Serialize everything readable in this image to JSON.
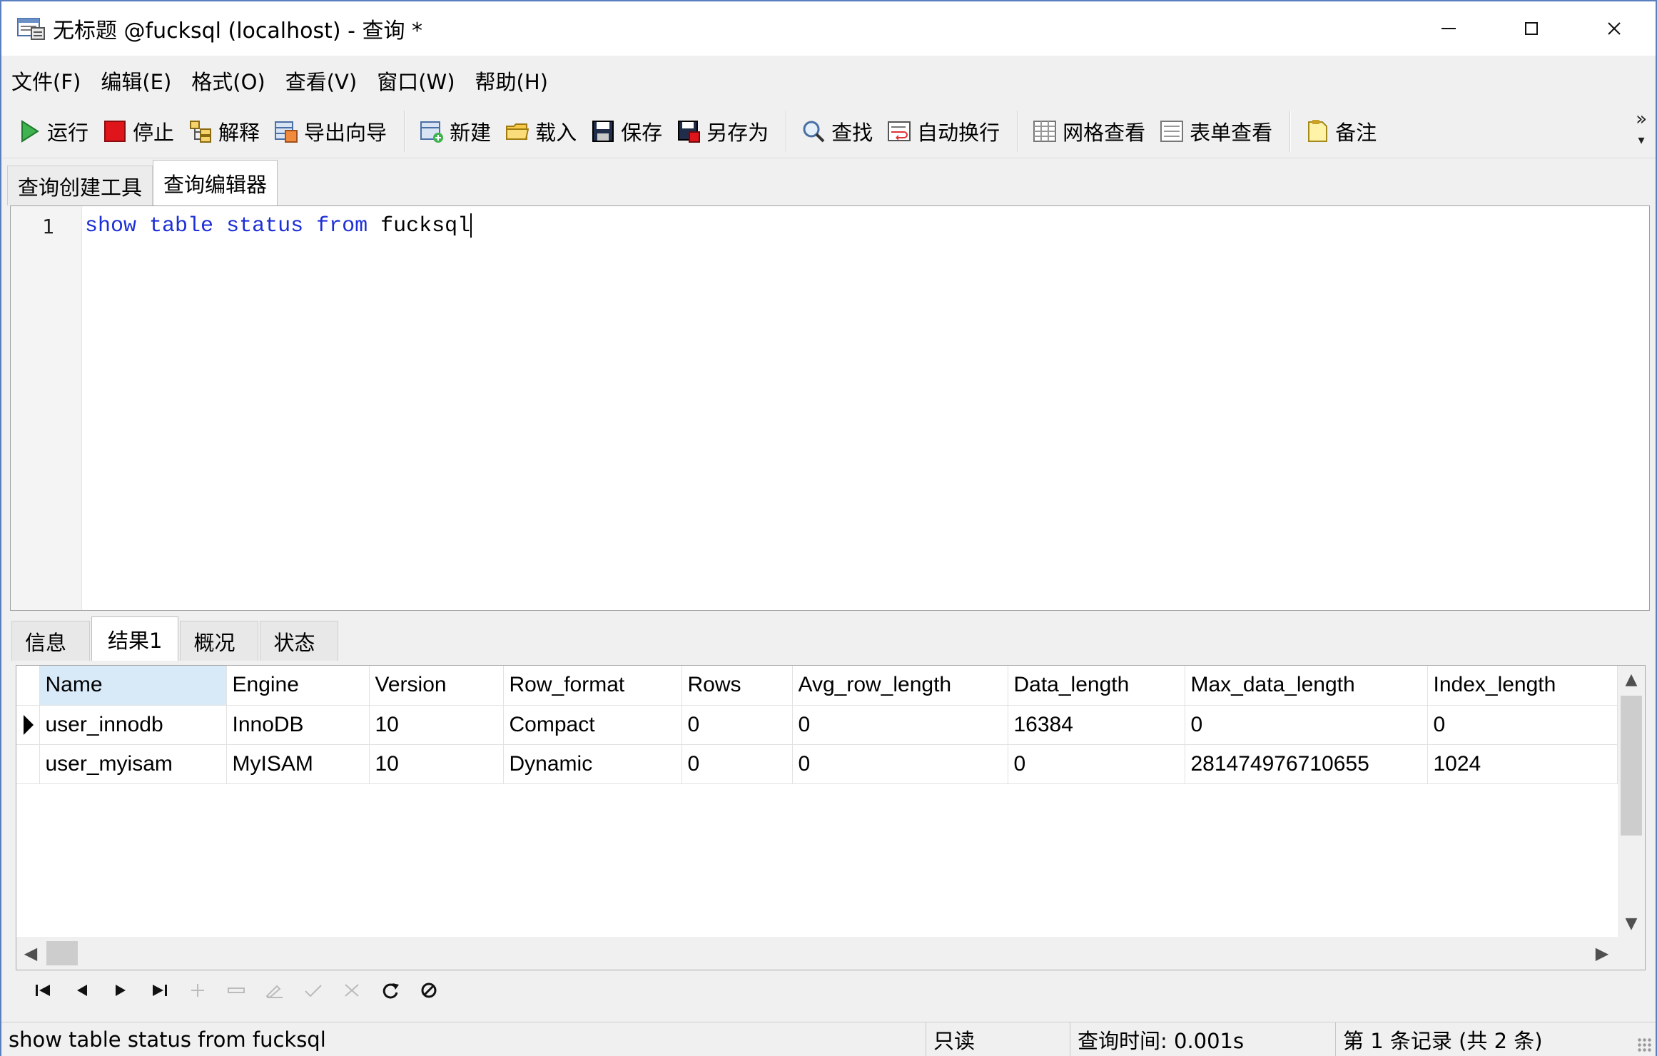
{
  "window": {
    "title": "无标题 @fucksql (localhost) - 查询 *",
    "minimize": "—",
    "maximize": "☐",
    "close": "✕"
  },
  "menu": [
    "文件(F)",
    "编辑(E)",
    "格式(O)",
    "查看(V)",
    "窗口(W)",
    "帮助(H)"
  ],
  "toolbar": {
    "run": "运行",
    "stop": "停止",
    "explain": "解释",
    "export": "导出向导",
    "new": "新建",
    "load": "载入",
    "save": "保存",
    "save_as": "另存为",
    "find": "查找",
    "word_wrap": "自动换行",
    "grid_view": "网格查看",
    "form_view": "表单查看",
    "note": "备注",
    "more": "»"
  },
  "query_tabs": {
    "builder": "查询创建工具",
    "editor": "查询编辑器"
  },
  "editor": {
    "line_number": "1",
    "code": {
      "kw1": "show",
      "kw2": "table",
      "kw3": "status",
      "kw4": "from",
      "ident": "fucksql"
    }
  },
  "result_tabs": {
    "info": "信息",
    "result1": "结果1",
    "profile": "概况",
    "status": "状态"
  },
  "grid": {
    "columns": [
      "Name",
      "Engine",
      "Version",
      "Row_format",
      "Rows",
      "Avg_row_length",
      "Data_length",
      "Max_data_length",
      "Index_length"
    ],
    "rows": [
      [
        "user_innodb",
        "InnoDB",
        "10",
        "Compact",
        "0",
        "0",
        "16384",
        "0",
        "0"
      ],
      [
        "user_myisam",
        "MyISAM",
        "10",
        "Dynamic",
        "0",
        "0",
        "0",
        "281474976710655",
        "1024"
      ]
    ]
  },
  "statusbar": {
    "query": "show table status from fucksql",
    "readonly": "只读",
    "query_time": "查询时间: 0.001s",
    "records": "第 1 条记录 (共 2 条)"
  },
  "colors": {
    "keyword": "#1c2fd6",
    "sorted_header": "#d8e9f8",
    "window_border": "#5a7fbf"
  }
}
